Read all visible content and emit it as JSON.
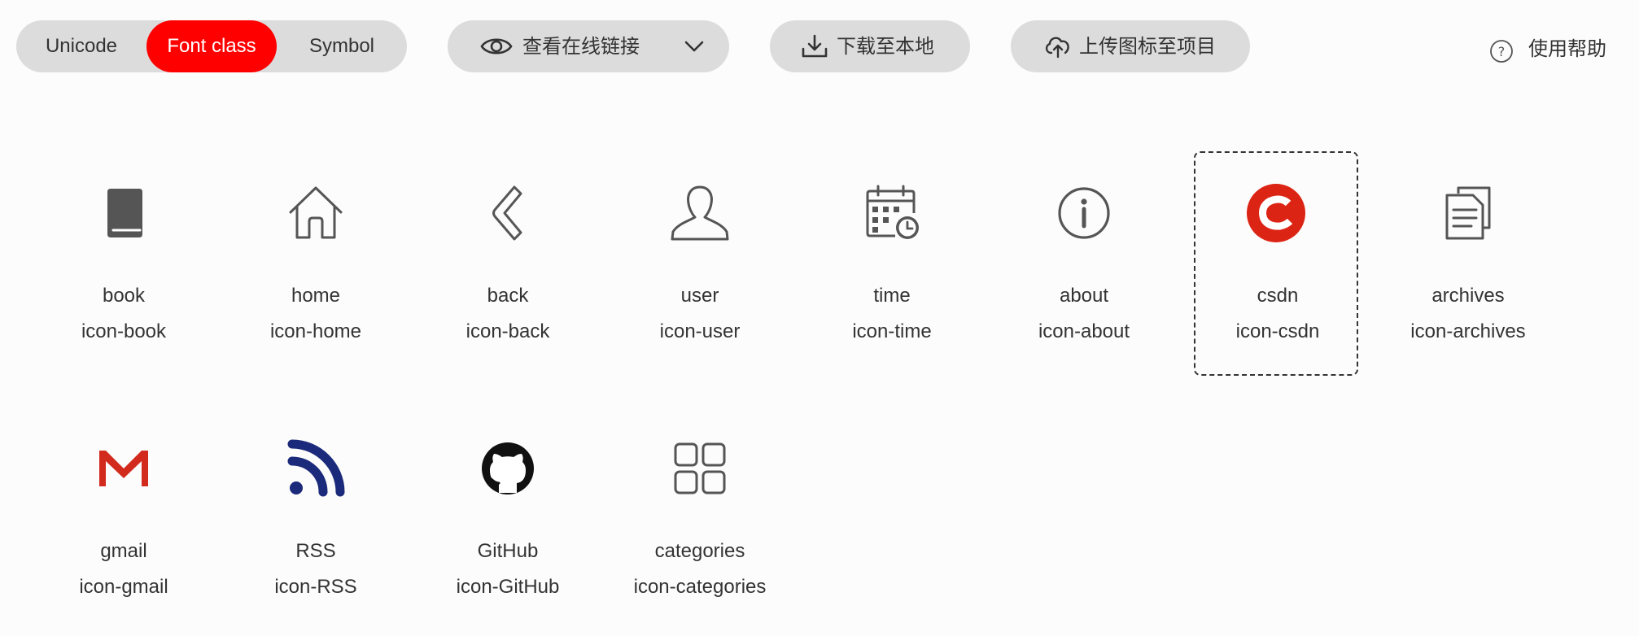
{
  "toolbar": {
    "tabs": [
      "Unicode",
      "Font class",
      "Symbol"
    ],
    "active_tab": "Font class",
    "view_online_label": "查看在线链接",
    "download_label": "下载至本地",
    "upload_label": "上传图标至项目",
    "help_label": "使用帮助"
  },
  "colors": {
    "accent": "#ff0000",
    "pill_bg": "#dcdcdc",
    "icon_gray": "#555555",
    "csdn_red": "#dc2414",
    "gmail_red": "#d22a1c",
    "rss_navy": "#1b2a7a",
    "text": "#333333"
  },
  "icons": [
    {
      "name": "book",
      "class": "icon-book",
      "icon": "book-icon"
    },
    {
      "name": "home",
      "class": "icon-home",
      "icon": "home-icon"
    },
    {
      "name": "back",
      "class": "icon-back",
      "icon": "back-icon"
    },
    {
      "name": "user",
      "class": "icon-user",
      "icon": "user-icon"
    },
    {
      "name": "time",
      "class": "icon-time",
      "icon": "time-icon"
    },
    {
      "name": "about",
      "class": "icon-about",
      "icon": "about-icon"
    },
    {
      "name": "csdn",
      "class": "icon-csdn",
      "icon": "csdn-icon",
      "selected": true
    },
    {
      "name": "archives",
      "class": "icon-archives",
      "icon": "archives-icon"
    },
    {
      "name": "gmail",
      "class": "icon-gmail",
      "icon": "gmail-icon"
    },
    {
      "name": "RSS",
      "class": "icon-RSS",
      "icon": "rss-icon"
    },
    {
      "name": "GitHub",
      "class": "icon-GitHub",
      "icon": "github-icon"
    },
    {
      "name": "categories",
      "class": "icon-categories",
      "icon": "categories-icon"
    }
  ]
}
